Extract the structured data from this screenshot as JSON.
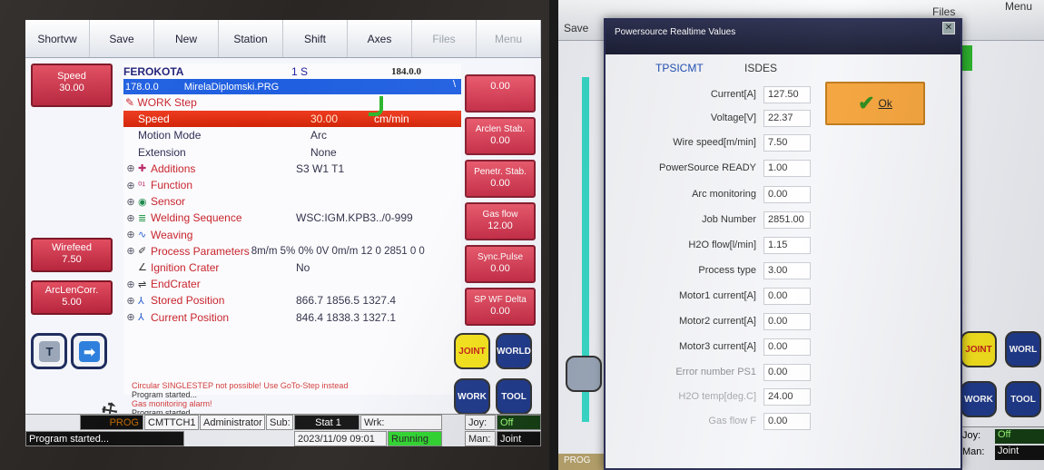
{
  "left": {
    "menu": [
      "Shortvw",
      "Save",
      "New",
      "Station",
      "Shift",
      "Axes",
      "Files",
      "Menu"
    ],
    "left_buttons": [
      {
        "label": "Speed",
        "value": "30.00"
      },
      {
        "label": "Wirefeed",
        "value": "7.50"
      },
      {
        "label": "ArcLenCorr.",
        "value": "5.00"
      }
    ],
    "right_buttons": [
      {
        "label": "",
        "value": "0.00"
      },
      {
        "label": "Arclen Stab.",
        "value": "0.00"
      },
      {
        "label": "Penetr. Stab.",
        "value": "0.00"
      },
      {
        "label": "Gas flow",
        "value": "12.00"
      },
      {
        "label": "Sync.Pulse",
        "value": "0.00"
      },
      {
        "label": "SP WF Delta",
        "value": "0.00"
      }
    ],
    "header": {
      "name": "FEROKOTA",
      "mode": "1 S",
      "version": "184.0.0"
    },
    "file": {
      "ver": "178.0.0",
      "name": "MirelaDiplomski.PRG",
      "tail": "\\"
    },
    "work_step": "WORK Step",
    "rows": [
      {
        "label": "Speed",
        "value": "30.00",
        "unit": "cm/min"
      },
      {
        "label": "Motion Mode",
        "value": "Arc"
      },
      {
        "label": "Extension",
        "value": "None"
      },
      {
        "label": "Additions",
        "value": "S3 W1 T1"
      },
      {
        "label": "Function",
        "value": ""
      },
      {
        "label": "Sensor",
        "value": ""
      },
      {
        "label": "Welding Sequence",
        "value": "WSC:IGM.KPB3../0-999"
      },
      {
        "label": "Weaving",
        "value": ""
      },
      {
        "label": "Process Parameters",
        "value": "8m/m 5% 0% 0V 0m/m 12 0 2851 0 0"
      },
      {
        "label": "Ignition Crater",
        "value": "No"
      },
      {
        "label": "EndCrater",
        "value": ""
      },
      {
        "label": "Stored Position",
        "value": "866.7 1856.5 1327.4"
      },
      {
        "label": "Current Position",
        "value": "846.4 1838.3 1327.1"
      }
    ],
    "messages": [
      "Circular SINGLESTEP not possible! Use GoTo-Step instead",
      "Program started...",
      "Gas monitoring alarm!",
      "Program started..."
    ],
    "modes": {
      "joint": "JOINT",
      "world": "WORLD",
      "work": "WORK",
      "tool": "TOOL"
    },
    "status": {
      "prog": "PROG",
      "cmt": "CMTTCH1",
      "user": "Administrator",
      "sub": "Sub:",
      "stat": "Stat 1",
      "wrk": "Wrk:",
      "program_started": "Program started...",
      "datetime": "2023/11/09 09:01",
      "running": "Running",
      "joy_label": "Joy:",
      "joy_value": "Off",
      "man_label": "Man:",
      "man_value": "Joint"
    }
  },
  "right": {
    "bg_menu": {
      "save": "Save",
      "files": "Files",
      "menu": "Menu"
    },
    "dialog_title": "Powersource Realtime Values",
    "col1": "TPSICMT",
    "col2": "ISDES",
    "ok": "Ok",
    "params": [
      {
        "label": "Current[A]",
        "value": "127.50"
      },
      {
        "label": "Voltage[V]",
        "value": "22.37"
      },
      {
        "label": "Wire speed[m/min]",
        "value": "7.50"
      },
      {
        "label": "PowerSource READY",
        "value": "1.00"
      },
      {
        "label": "Arc monitoring",
        "value": "0.00"
      },
      {
        "label": "Job Number",
        "value": "2851.00"
      },
      {
        "label": "H2O flow[l/min]",
        "value": "1.15"
      },
      {
        "label": "Process type",
        "value": "3.00"
      },
      {
        "label": "Motor1 current[A]",
        "value": "0.00"
      },
      {
        "label": "Motor2 current[A]",
        "value": "0.00"
      },
      {
        "label": "Motor3 current[A]",
        "value": "0.00"
      },
      {
        "label": "Error number PS1",
        "value": "0.00"
      },
      {
        "label": "H2O temp[deg.C]",
        "value": "24.00"
      },
      {
        "label": "Gas flow F",
        "value": "0.00"
      }
    ],
    "bg_modes": {
      "joint": "JOINT",
      "world": "WORL",
      "work": "WORK",
      "tool": "TOOL"
    },
    "bg_status": {
      "prog": "PROG",
      "joy": "Joy:",
      "joy_v": "Off",
      "man": "Man:",
      "man_v": "Joint"
    }
  },
  "colors": {
    "accent_red": "#c8242d",
    "selection": "#e02f12",
    "file_bar": "#1f5fe0",
    "ok_button": "#f4a43c"
  }
}
